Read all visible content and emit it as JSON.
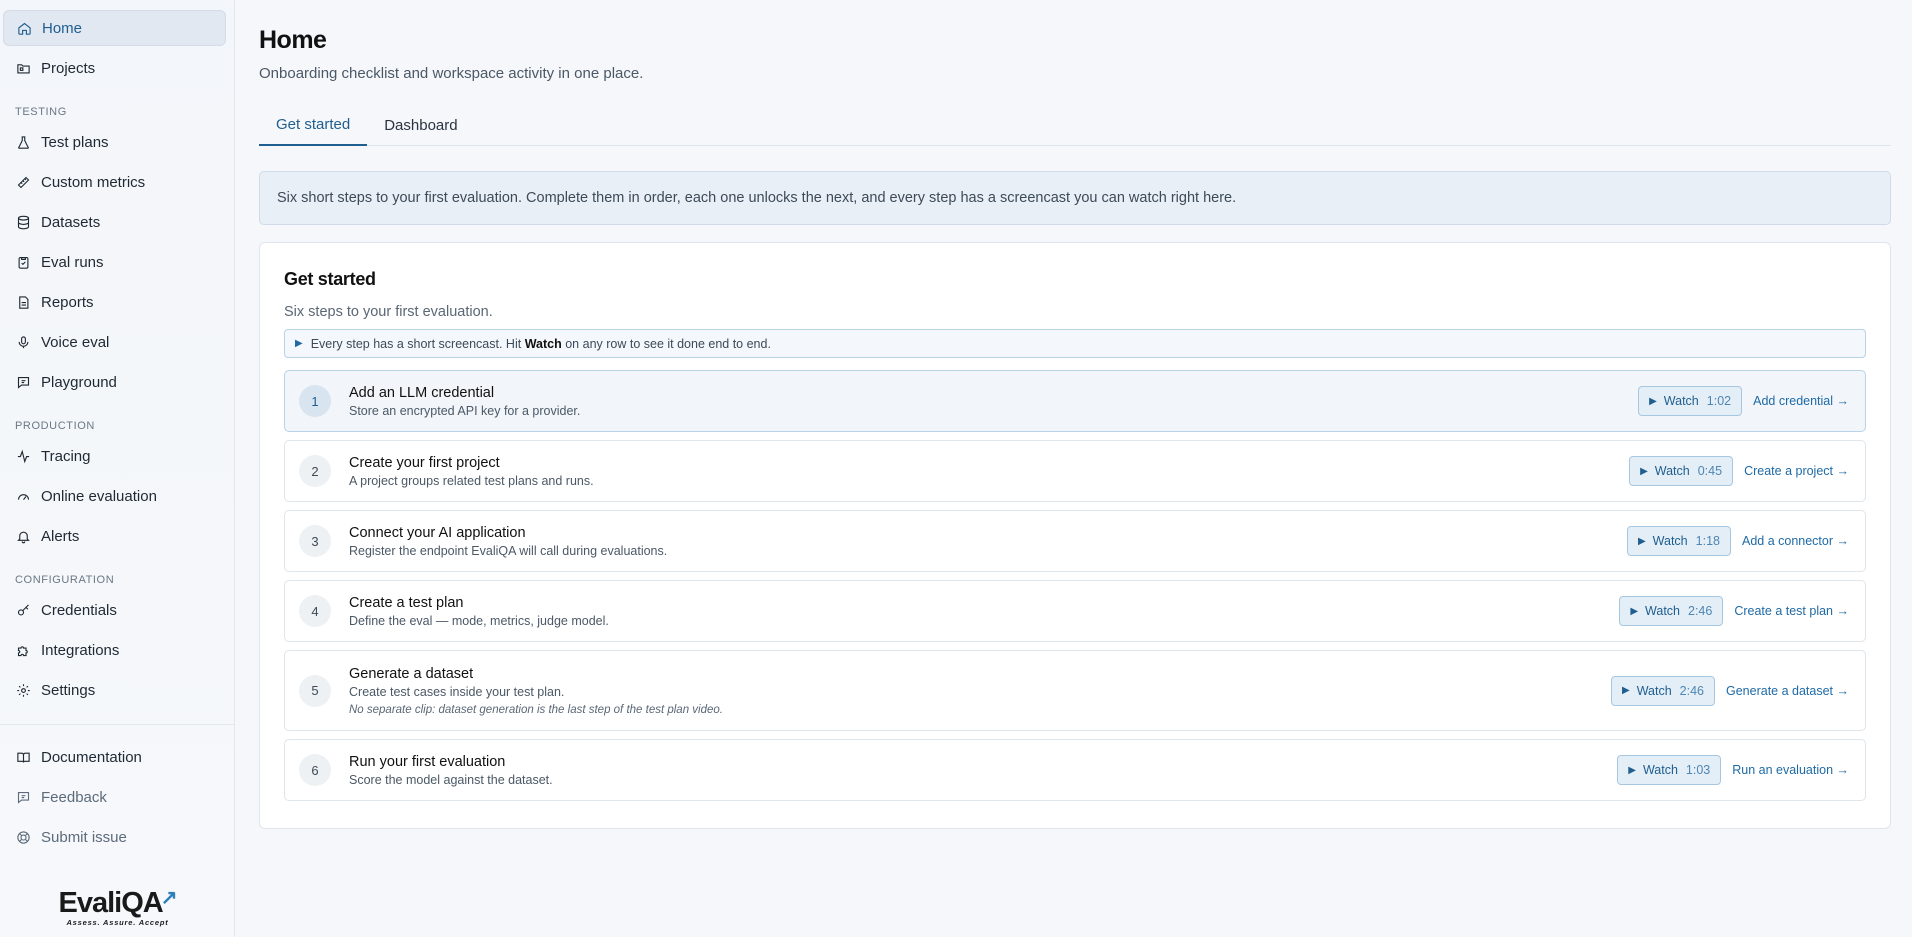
{
  "sidebar": {
    "top_items": [
      {
        "label": "Home",
        "icon": "home-icon"
      },
      {
        "label": "Projects",
        "icon": "folder-icon"
      }
    ],
    "sections": [
      {
        "label": "TESTING",
        "items": [
          {
            "label": "Test plans",
            "icon": "flask-icon"
          },
          {
            "label": "Custom metrics",
            "icon": "ruler-icon"
          },
          {
            "label": "Datasets",
            "icon": "database-icon"
          },
          {
            "label": "Eval runs",
            "icon": "clipboard-check-icon"
          },
          {
            "label": "Reports",
            "icon": "report-icon"
          },
          {
            "label": "Voice eval",
            "icon": "microphone-icon"
          },
          {
            "label": "Playground",
            "icon": "chat-icon"
          }
        ]
      },
      {
        "label": "PRODUCTION",
        "items": [
          {
            "label": "Tracing",
            "icon": "activity-icon"
          },
          {
            "label": "Online evaluation",
            "icon": "gauge-icon"
          },
          {
            "label": "Alerts",
            "icon": "bell-icon"
          }
        ]
      },
      {
        "label": "CONFIGURATION",
        "items": [
          {
            "label": "Credentials",
            "icon": "key-icon"
          },
          {
            "label": "Integrations",
            "icon": "puzzle-icon"
          },
          {
            "label": "Settings",
            "icon": "gear-icon"
          }
        ]
      }
    ],
    "bottom_items": [
      {
        "label": "Documentation",
        "icon": "book-icon"
      },
      {
        "label": "Feedback",
        "icon": "message-icon"
      },
      {
        "label": "Submit issue",
        "icon": "lifebuoy-icon"
      }
    ],
    "logo": {
      "word": "Evali",
      "word2": "QA",
      "tagline": "Assess. Assure. Accept"
    }
  },
  "header": {
    "title": "Home",
    "subtitle": "Onboarding checklist and workspace activity in one place."
  },
  "tabs": [
    "Get started",
    "Dashboard"
  ],
  "banner": "Six short steps to your first evaluation. Complete them in order, each one unlocks the next, and every step has a screencast you can watch right here.",
  "card": {
    "title": "Get started",
    "subtitle": "Six steps to your first evaluation.",
    "hint_pre": "Every step has a short screencast. Hit",
    "hint_bold": "Watch",
    "hint_post": "on any row to see it done end to end.",
    "watch_label": "Watch",
    "steps": [
      {
        "num": "1",
        "title": "Add an LLM credential",
        "desc": "Store an encrypted API key for a provider.",
        "note": "",
        "duration": "1:02",
        "action": "Add credential →"
      },
      {
        "num": "2",
        "title": "Create your first project",
        "desc": "A project groups related test plans and runs.",
        "note": "",
        "duration": "0:45",
        "action": "Create a project →"
      },
      {
        "num": "3",
        "title": "Connect your AI application",
        "desc": "Register the endpoint EvaliQA will call during evaluations.",
        "note": "",
        "duration": "1:18",
        "action": "Add a connector →"
      },
      {
        "num": "4",
        "title": "Create a test plan",
        "desc": "Define the eval — mode, metrics, judge model.",
        "note": "",
        "duration": "2:46",
        "action": "Create a test plan →"
      },
      {
        "num": "5",
        "title": "Generate a dataset",
        "desc": "Create test cases inside your test plan.",
        "note": "No separate clip: dataset generation is the last step of the test plan video.",
        "duration": "2:46",
        "action": "Generate a dataset →"
      },
      {
        "num": "6",
        "title": "Run your first evaluation",
        "desc": "Score the model against the dataset.",
        "note": "",
        "duration": "1:03",
        "action": "Run an evaluation →"
      }
    ]
  }
}
